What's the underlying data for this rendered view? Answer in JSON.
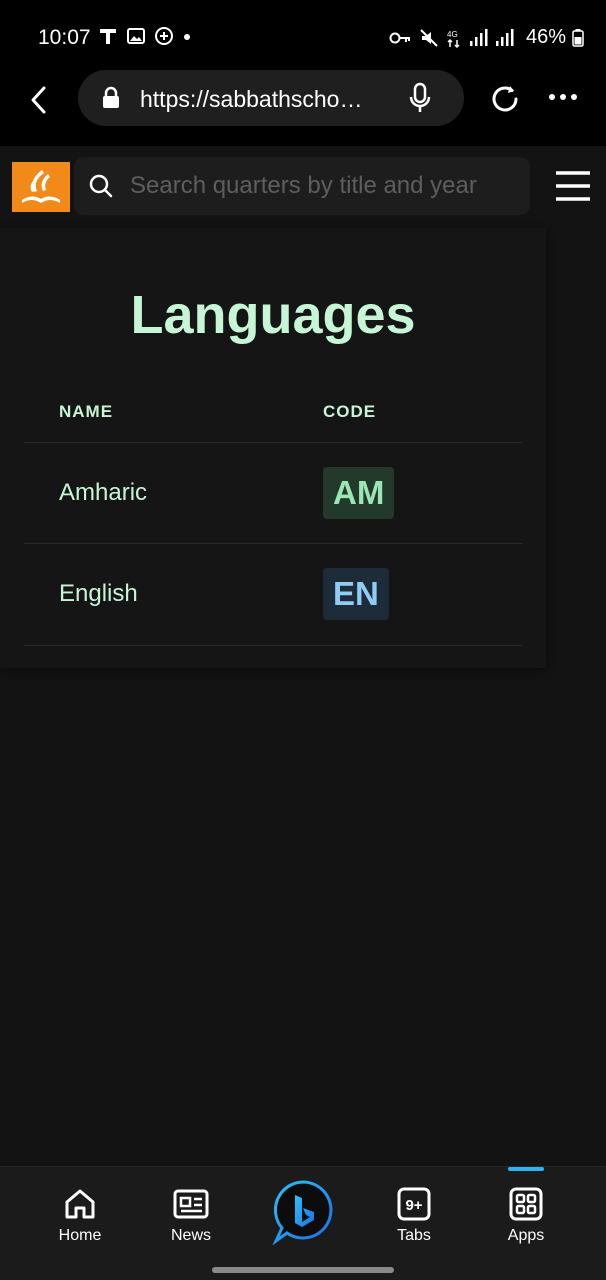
{
  "status": {
    "time": "10:07",
    "network": "4G",
    "battery": "46%",
    "left_icons": [
      "t-icon",
      "image-icon",
      "chat-plus-icon",
      "dot-icon"
    ],
    "right_icons": [
      "key-icon",
      "mute-icon",
      "data-icon",
      "signal-icon",
      "signal-icon",
      "battery-icon"
    ]
  },
  "browser": {
    "url": "https://sabbathscho…"
  },
  "header": {
    "search_placeholder": "Search quarters by title and year"
  },
  "main": {
    "title": "Languages",
    "columns": [
      "NAME",
      "CODE"
    ],
    "rows": [
      {
        "name": "Amharic",
        "code": "AM",
        "badge_color": "#9ae6b4"
      },
      {
        "name": "English",
        "code": "EN",
        "badge_color": "#90cdf4"
      }
    ]
  },
  "bottom_nav": {
    "items": [
      {
        "label": "Home",
        "icon": "home-icon"
      },
      {
        "label": "News",
        "icon": "news-icon"
      },
      {
        "label": "Tabs",
        "icon": "tabs-icon",
        "badge": "9+"
      },
      {
        "label": "Apps",
        "icon": "apps-icon"
      }
    ],
    "active": "Apps"
  },
  "colors": {
    "accent_text": "#c6f6d5",
    "logo_bg": "#f28a1a",
    "active_indicator": "#2fb3f0"
  }
}
